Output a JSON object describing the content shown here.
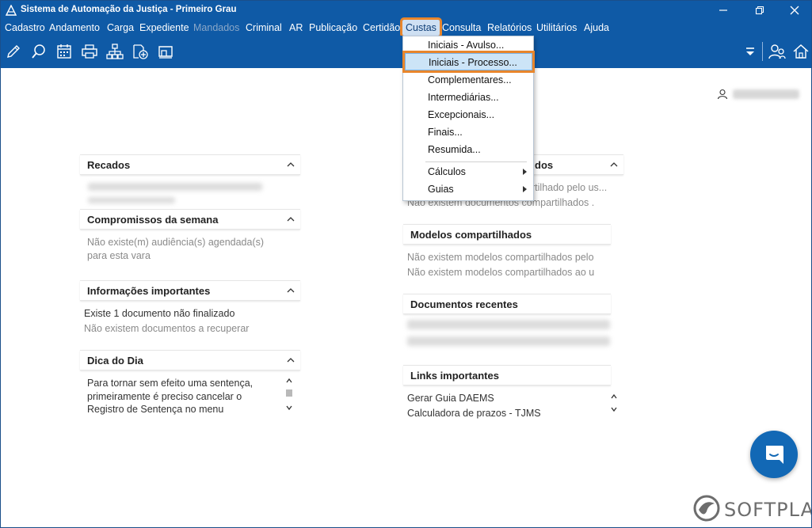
{
  "window": {
    "title": "Sistema de Automação da Justiça - Primeiro Grau"
  },
  "menubar": {
    "items": [
      {
        "label": "Cadastro",
        "disabled": false
      },
      {
        "label": "Andamento",
        "disabled": false
      },
      {
        "label": "Carga",
        "disabled": false
      },
      {
        "label": "Expediente",
        "disabled": false
      },
      {
        "label": "Mandados",
        "disabled": true
      },
      {
        "label": "Criminal",
        "disabled": false
      },
      {
        "label": "AR",
        "disabled": false
      },
      {
        "label": "Publicação",
        "disabled": false
      },
      {
        "label": "Certidão",
        "disabled": false
      },
      {
        "label": "Custas",
        "disabled": false,
        "active": true
      },
      {
        "label": "Consulta",
        "disabled": false
      },
      {
        "label": "Relatórios",
        "disabled": false
      },
      {
        "label": "Utilitários",
        "disabled": false
      },
      {
        "label": "Ajuda",
        "disabled": false
      }
    ]
  },
  "toolbar": {
    "icons": [
      "edit-icon",
      "search-process-icon",
      "calendar-icon",
      "printer-icon",
      "hierarchy-icon",
      "add-document-icon",
      "folder-icon",
      "dropdown-icon",
      "users-icon",
      "home-icon"
    ]
  },
  "custas_menu": {
    "items": [
      {
        "label": "Iniciais - Avulso...",
        "highlighted": false,
        "submenu": false
      },
      {
        "label": "Iniciais - Processo...",
        "highlighted": true,
        "submenu": false
      },
      {
        "label": "Complementares...",
        "highlighted": false,
        "submenu": false
      },
      {
        "label": "Intermediárias...",
        "highlighted": false,
        "submenu": false
      },
      {
        "label": "Excepcionais...",
        "highlighted": false,
        "submenu": false
      },
      {
        "label": "Finais...",
        "highlighted": false,
        "submenu": false
      },
      {
        "label": "Resumida...",
        "highlighted": false,
        "submenu": false
      },
      {
        "label": "Cálculos",
        "highlighted": false,
        "submenu": true
      },
      {
        "label": "Guias",
        "highlighted": false,
        "submenu": true
      }
    ]
  },
  "left_panels": {
    "recados": {
      "title": "Recados"
    },
    "compromissos": {
      "title": "Compromissos da semana",
      "lines": [
        "Não existe(m) audiência(s) agendada(s)",
        "para esta vara"
      ]
    },
    "informacoes": {
      "title": "Informações importantes",
      "lines": [
        "Existe 1 documento não finalizado",
        "Não existem documentos a recuperar"
      ]
    },
    "dica": {
      "title": "Dica do Dia",
      "lines": [
        "Para tornar sem efeito uma sentença,",
        "primeiramente é preciso cancelar o",
        "Registro de Sentença no menu"
      ]
    }
  },
  "right_panels": {
    "documentos_compartilhados": {
      "title_suffix": "dos",
      "lines": [
        "rtilhado pelo us...",
        "Não existem documentos compartilhados ."
      ]
    },
    "modelos": {
      "title": "Modelos compartilhados",
      "lines": [
        "Não existem modelos compartilhados pelo",
        "Não existem modelos compartilhados ao u"
      ]
    },
    "recentes": {
      "title": "Documentos recentes"
    },
    "links": {
      "title": "Links importantes",
      "lines": [
        "Gerar Guia DAEMS",
        "Calculadora de prazos - TJMS"
      ]
    }
  },
  "brand": {
    "text": "SOFTPLAN"
  },
  "colors": {
    "primary": "#0f5aa6",
    "highlight_outline": "#e8862c",
    "menu_highlight": "#cce4f7",
    "chat_button": "#1268b5"
  }
}
